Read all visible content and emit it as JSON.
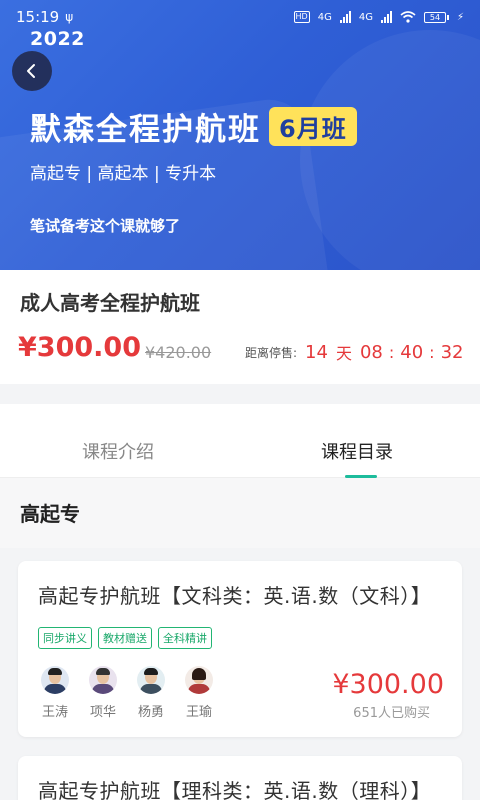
{
  "status": {
    "time": "15:19",
    "usb_icon": "ψ",
    "hd": "HD",
    "net1": "4G",
    "net2": "4G",
    "battery": "54"
  },
  "banner": {
    "year": "2022",
    "title": "默森全程护航班",
    "tag": "6月班",
    "subtitle": "高起专 | 高起本 | 专升本",
    "note": "笔试备考这个课就够了",
    "colors": {
      "start": "#3b6fe0",
      "end": "#2b53c9",
      "tag_bg": "#ffe25a"
    }
  },
  "course": {
    "title": "成人高考全程护航班",
    "price": "¥300.00",
    "old_price": "¥420.00",
    "countdown": {
      "label": "距离停售:",
      "days": "14",
      "days_unit": "天",
      "hours": "08",
      "minutes": "40",
      "seconds": "32",
      "separator": ":"
    }
  },
  "tabs": [
    {
      "label": "课程介绍",
      "active": false
    },
    {
      "label": "课程目录",
      "active": true
    }
  ],
  "section": {
    "title": "高起专"
  },
  "cards": [
    {
      "title": "高起专护航班【文科类：英.语.数（文科）】",
      "tags": [
        "同步讲义",
        "教材赠送",
        "全科精讲"
      ],
      "teachers": [
        "王涛",
        "项华",
        "杨勇",
        "王瑜"
      ],
      "price": "¥300.00",
      "sold": "651人已购买"
    },
    {
      "title": "高起专护航班【理科类：英.语.数（理科）】"
    }
  ],
  "colors": {
    "accent": "#1dbc9c",
    "price": "#e5393b",
    "tag": "#22b573"
  }
}
